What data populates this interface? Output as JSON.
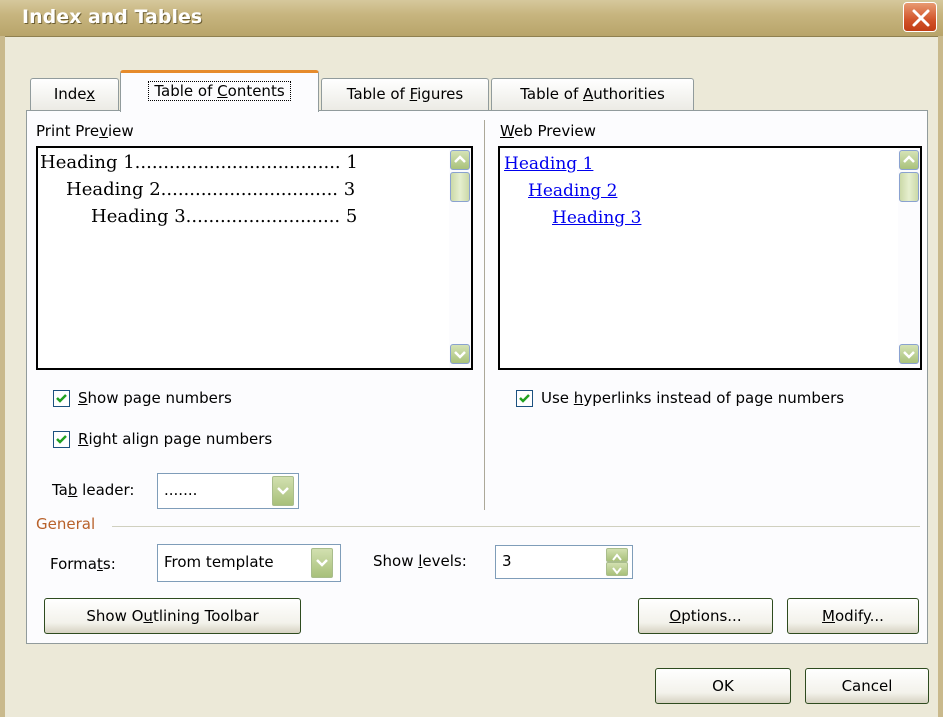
{
  "window": {
    "title": "Index and Tables"
  },
  "tabs": [
    {
      "label": "Index",
      "mnemonic_pre": "Inde",
      "mnemonic": "x",
      "mnemonic_post": ""
    },
    {
      "label": "Table of Contents",
      "mnemonic_pre": "Table of ",
      "mnemonic": "C",
      "mnemonic_post": "ontents"
    },
    {
      "label": "Table of Figures",
      "mnemonic_pre": "Table of ",
      "mnemonic": "F",
      "mnemonic_post": "igures"
    },
    {
      "label": "Table of Authorities",
      "mnemonic_pre": "Table of ",
      "mnemonic": "A",
      "mnemonic_post": "uthorities"
    }
  ],
  "print_preview": {
    "label_pre": "Print Pre",
    "label_mn": "v",
    "label_post": "iew",
    "lines": [
      {
        "text": "Heading 1",
        "dots": "....................................",
        "page": "1"
      },
      {
        "text": "Heading 2",
        "dots": "...............................",
        "page": "3"
      },
      {
        "text": "Heading 3",
        "dots": "...........................",
        "page": "5"
      }
    ]
  },
  "web_preview": {
    "label_pre": "",
    "label_mn": "W",
    "label_post": "eb Preview",
    "links": [
      "Heading 1",
      "Heading 2",
      "Heading 3"
    ]
  },
  "options": {
    "show_page_numbers": {
      "pre": "",
      "mn": "S",
      "post": "how page numbers",
      "checked": true
    },
    "right_align": {
      "pre": "",
      "mn": "R",
      "post": "ight align page numbers",
      "checked": true
    },
    "use_hyperlinks": {
      "pre": "Use ",
      "mn": "h",
      "post": "yperlinks instead of page numbers",
      "checked": true
    },
    "tab_leader": {
      "pre": "Ta",
      "mn": "b",
      "post": " leader:",
      "value": "......."
    }
  },
  "general": {
    "label": "General",
    "formats": {
      "pre": "Forma",
      "mn": "t",
      "post": "s:",
      "value": "From template"
    },
    "show_levels": {
      "pre": "Show ",
      "mn": "l",
      "post": "evels:",
      "value": "3"
    }
  },
  "buttons": {
    "outlining": {
      "pre": "Show O",
      "mn": "u",
      "post": "tlining Toolbar"
    },
    "options": {
      "pre": "",
      "mn": "O",
      "post": "ptions..."
    },
    "modify": {
      "pre": "",
      "mn": "M",
      "post": "odify..."
    },
    "ok": "OK",
    "cancel": "Cancel"
  },
  "colors": {
    "accent_tab": "#e68b2c",
    "link": "#0000ee",
    "group_label": "#b8612a"
  }
}
